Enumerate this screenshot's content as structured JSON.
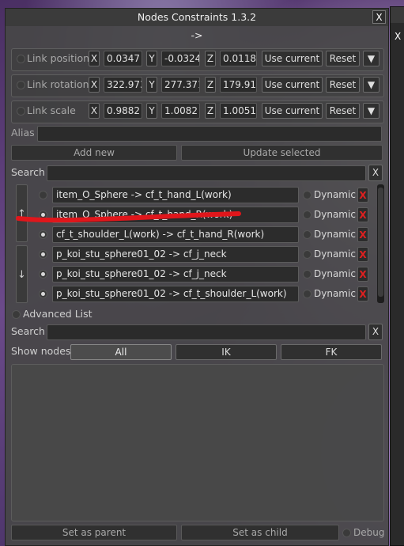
{
  "window": {
    "title": "Nodes Constraints 1.3.2",
    "close": "X",
    "arrow": "->"
  },
  "side_panel": {
    "close": "X"
  },
  "links": [
    {
      "label": "Link position",
      "x": "0.0347",
      "y": "-0.0324",
      "z": "0.0118"
    },
    {
      "label": "Link rotation",
      "x": "322.973",
      "y": "277.371",
      "z": "179.917"
    },
    {
      "label": "Link scale",
      "x": "0.9882",
      "y": "1.0082",
      "z": "1.0051"
    }
  ],
  "axes": {
    "x": "X",
    "y": "Y",
    "z": "Z"
  },
  "link_buttons": {
    "use_current": "Use current",
    "reset": "Reset",
    "dropdown": "▼"
  },
  "alias": {
    "label": "Alias",
    "value": ""
  },
  "actions": {
    "add_new": "Add new",
    "update_selected": "Update selected"
  },
  "search1": {
    "label": "Search",
    "value": "",
    "clear": "X"
  },
  "constraints": [
    {
      "name": "item_O_Sphere -> cf_t_hand_L(work)",
      "selected": false
    },
    {
      "name": "item_O_Sphere -> cf_t_hand_R(work)",
      "selected": true
    },
    {
      "name": "cf_t_shoulder_L(work) -> cf_t_hand_R(work)",
      "selected": true
    },
    {
      "name": "p_koi_stu_sphere01_02 -> cf_j_neck",
      "selected": true
    },
    {
      "name": "p_koi_stu_sphere01_02 -> cf_j_neck",
      "selected": true
    },
    {
      "name": "p_koi_stu_sphere01_02 -> cf_t_shoulder_L(work)",
      "selected": true
    }
  ],
  "row_labels": {
    "dynamic": "Dynamic",
    "delete": "X"
  },
  "move_buttons": {
    "up": "↑",
    "down": "↓"
  },
  "advanced": {
    "label": "Advanced List"
  },
  "search2": {
    "label": "Search",
    "value": "",
    "clear": "X"
  },
  "show_nodes": {
    "label": "Show nodes",
    "tabs": [
      "All",
      "IK",
      "FK"
    ],
    "active": "All"
  },
  "bottom": {
    "set_parent": "Set as parent",
    "set_child": "Set as child",
    "debug": "Debug"
  },
  "colors": {
    "annotation_red": "#e0161b",
    "delete_red": "#e02020"
  }
}
